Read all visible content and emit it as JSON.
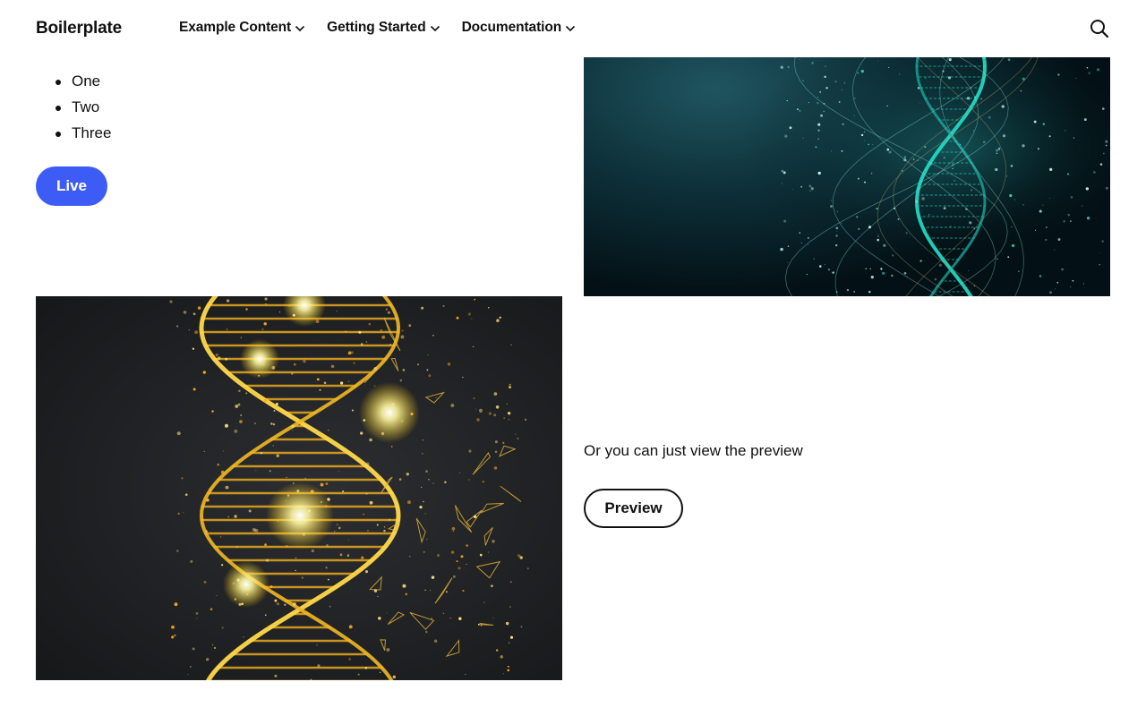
{
  "header": {
    "logo": "Boilerplate",
    "nav": [
      {
        "label": "Example Content"
      },
      {
        "label": "Getting Started"
      },
      {
        "label": "Documentation"
      }
    ],
    "search_icon": "search-icon",
    "chevron_icon": "chevron-down-icon"
  },
  "main": {
    "list": [
      "One",
      "Two",
      "Three"
    ],
    "live_button": "Live",
    "preview_text": "Or you can just view the preview",
    "preview_button": "Preview"
  },
  "images": {
    "teal": "teal-dna-helix-image",
    "gold": "gold-dna-helix-image"
  },
  "colors": {
    "accent": "#3d5cf5",
    "text": "#111111",
    "background": "#ffffff"
  }
}
